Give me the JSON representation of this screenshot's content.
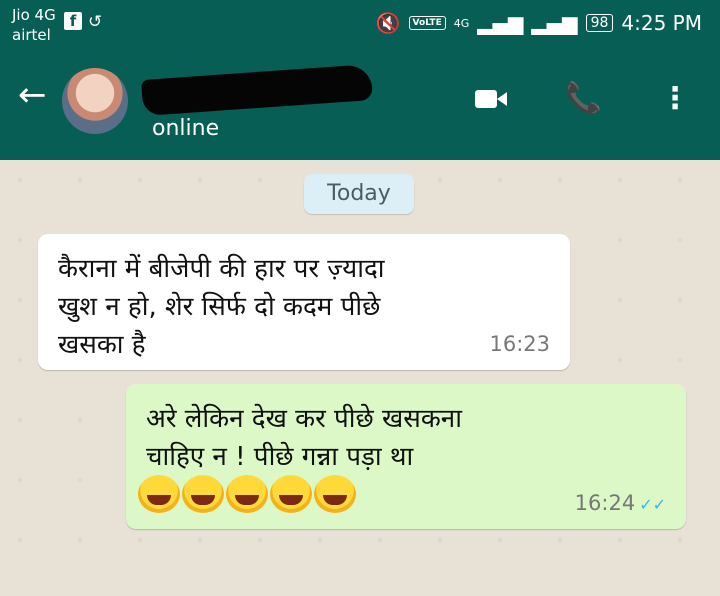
{
  "status_bar": {
    "carrier_network": "Jio 4G",
    "carrier_name": "airtel",
    "volte": "VoLTE",
    "network": "4G",
    "battery": "98",
    "time": "4:25 PM"
  },
  "header": {
    "status": "online"
  },
  "chat": {
    "date_label": "Today",
    "messages": [
      {
        "direction": "incoming",
        "text": "कैराना में बीजेपी की हार पर ज़्यादा\nखुश न हो, शेर सिर्फ दो कदम पीछे\nखसका है",
        "time": "16:23"
      },
      {
        "direction": "outgoing",
        "text": "अरे लेकिन देख कर पीछे खसकना\nचाहिए न ! पीछे गन्ना पड़ा था",
        "emoji": "😂😂😂😂😂",
        "time": "16:24",
        "read": true
      }
    ]
  },
  "colors": {
    "header": "#075e54",
    "outgoing_bubble": "#dcf8c6",
    "incoming_bubble": "#ffffff",
    "read_ticks": "#34b7f1"
  },
  "icons": [
    "facebook-icon",
    "whatsapp-icon",
    "mute-icon",
    "signal-icon",
    "battery-icon",
    "back-arrow-icon",
    "video-call-icon",
    "phone-icon",
    "more-options-icon",
    "read-ticks-icon"
  ]
}
